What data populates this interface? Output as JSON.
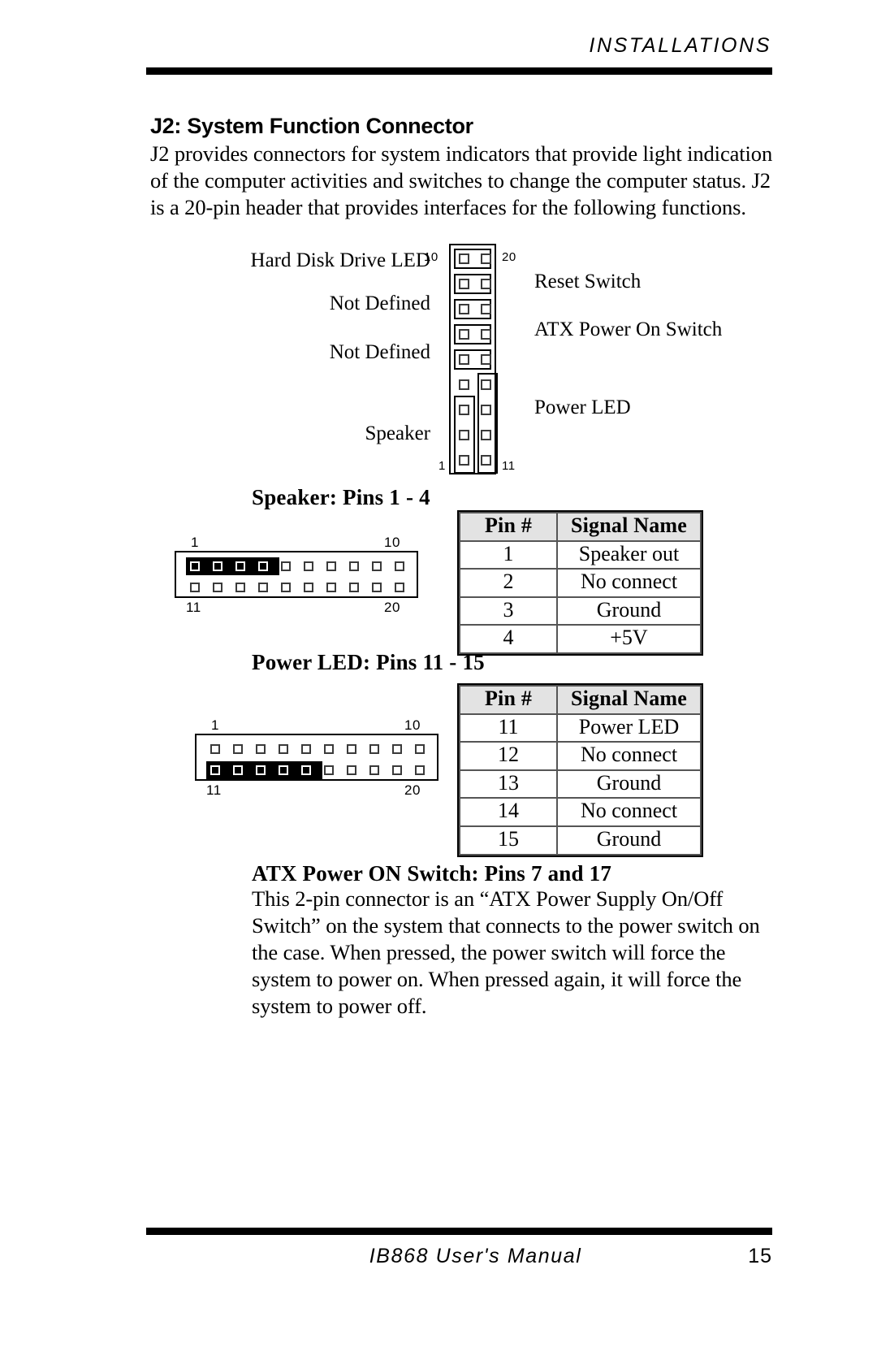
{
  "header": {
    "title": "INSTALLATIONS"
  },
  "footer": {
    "manual": "IB868 User's Manual",
    "page_number": "15"
  },
  "section": {
    "title": "J2: System Function Connector",
    "paragraph_lines": [
      "J2 provides connectors for system indicators that provide light indication",
      "of the computer activities and switches to change the computer status. J2",
      "is a 20-pin header that provides interfaces for the following functions."
    ]
  },
  "j2_diagram": {
    "left_labels": [
      "Hard Disk Drive LED",
      "Not Defined",
      "Not Defined",
      "Speaker"
    ],
    "right_labels": [
      "Reset Switch",
      "ATX Power On Switch",
      "Power LED"
    ],
    "pin_numbers": {
      "top_left": "10",
      "top_right": "20",
      "bottom_left": "1",
      "bottom_right": "11"
    }
  },
  "speaker_section": {
    "heading": "Speaker: Pins 1 - 4",
    "diagram": {
      "top_left_num": "1",
      "top_right_num": "10",
      "bottom_left_num": "11",
      "bottom_right_num": "20",
      "highlighted_row": "top",
      "highlighted_count": 4
    },
    "table": {
      "columns": [
        "Pin #",
        "Signal Name"
      ],
      "rows": [
        [
          "1",
          "Speaker out"
        ],
        [
          "2",
          "No connect"
        ],
        [
          "3",
          "Ground"
        ],
        [
          "4",
          "+5V"
        ]
      ]
    }
  },
  "power_led_section": {
    "heading": "Power LED: Pins 11 - 15",
    "diagram": {
      "top_left_num": "1",
      "top_right_num": "10",
      "bottom_left_num": "11",
      "bottom_right_num": "20",
      "highlighted_row": "bottom",
      "highlighted_count": 5
    },
    "table": {
      "columns": [
        "Pin #",
        "Signal Name"
      ],
      "rows": [
        [
          "11",
          "Power LED"
        ],
        [
          "12",
          "No connect"
        ],
        [
          "13",
          "Ground"
        ],
        [
          "14",
          "No connect"
        ],
        [
          "15",
          "Ground"
        ]
      ]
    }
  },
  "atx_section": {
    "heading": "ATX Power ON Switch: Pins 7 and 17",
    "paragraph_lines": [
      "This 2-pin connector is an “ATX Power Supply On/Off",
      "Switch” on the system that connects to the power switch on",
      "the case. When pressed, the power switch will force the",
      "system to power on. When pressed again, it will force the",
      "system to power off."
    ]
  }
}
